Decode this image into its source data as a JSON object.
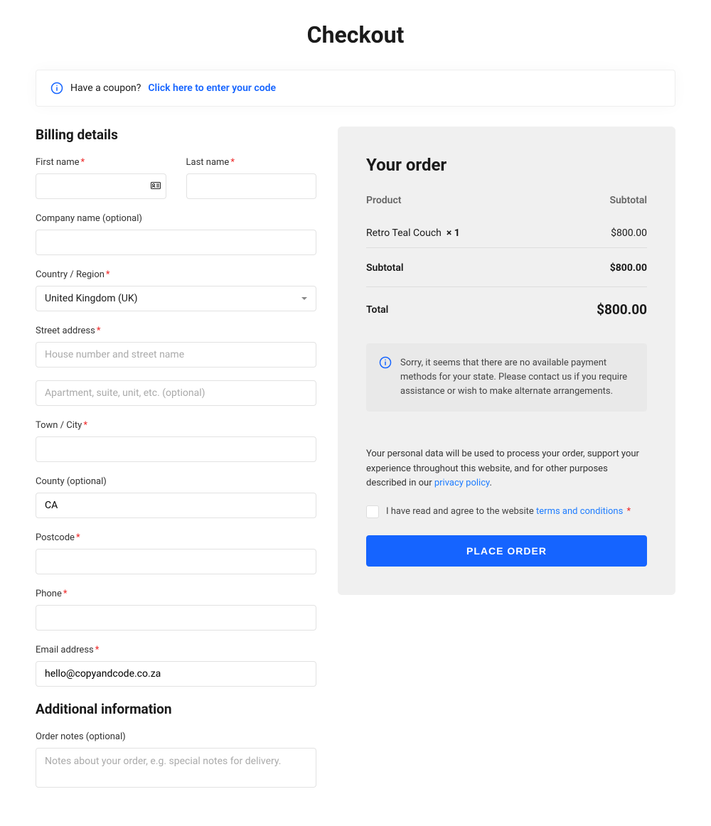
{
  "title": "Checkout",
  "coupon": {
    "prompt": "Have a coupon?",
    "link": "Click here to enter your code"
  },
  "billing": {
    "heading": "Billing details",
    "first_name": "First name",
    "last_name": "Last name",
    "company": "Company name (optional)",
    "country": "Country / Region",
    "country_value": "United Kingdom (UK)",
    "street": "Street address",
    "street_ph1": "House number and street name",
    "street_ph2": "Apartment, suite, unit, etc. (optional)",
    "city": "Town / City",
    "county": "County (optional)",
    "county_value": "CA",
    "postcode": "Postcode",
    "phone": "Phone",
    "email": "Email address",
    "email_value": "hello@copyandcode.co.za"
  },
  "additional": {
    "heading": "Additional information",
    "notes_label": "Order notes (optional)",
    "notes_ph": "Notes about your order, e.g. special notes for delivery."
  },
  "order": {
    "heading": "Your order",
    "th_product": "Product",
    "th_subtotal": "Subtotal",
    "item_name": "Retro Teal Couch",
    "item_qty": "× 1",
    "item_price": "$800.00",
    "subtotal_label": "Subtotal",
    "subtotal_value": "$800.00",
    "total_label": "Total",
    "total_value": "$800.00",
    "payment_notice": "Sorry, it seems that there are no available payment methods for your state. Please contact us if you require assistance or wish to make alternate arrangements.",
    "privacy_text": "Your personal data will be used to process your order, support your experience throughout this website, and for other purposes described in our ",
    "privacy_link": "privacy policy",
    "terms_text": "I have read and agree to the website ",
    "terms_link": "terms and conditions",
    "place_btn": "PLACE ORDER"
  }
}
